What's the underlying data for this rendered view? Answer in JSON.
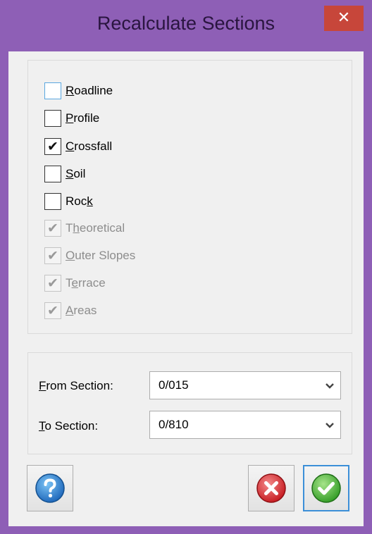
{
  "window": {
    "title": "Recalculate Sections",
    "close_glyph": "✕"
  },
  "checkboxes": [
    {
      "pre": "",
      "ak": "R",
      "post": "oadline",
      "checked": false,
      "enabled": true
    },
    {
      "pre": "",
      "ak": "P",
      "post": "rofile",
      "checked": false,
      "enabled": true
    },
    {
      "pre": "",
      "ak": "C",
      "post": "rossfall",
      "checked": true,
      "enabled": true
    },
    {
      "pre": "",
      "ak": "S",
      "post": "oil",
      "checked": false,
      "enabled": true
    },
    {
      "pre": "Roc",
      "ak": "k",
      "post": "",
      "checked": false,
      "enabled": true
    },
    {
      "pre": "T",
      "ak": "h",
      "post": "eoretical",
      "checked": true,
      "enabled": false
    },
    {
      "pre": "",
      "ak": "O",
      "post": "uter Slopes",
      "checked": true,
      "enabled": false
    },
    {
      "pre": "T",
      "ak": "e",
      "post": "rrace",
      "checked": true,
      "enabled": false
    },
    {
      "pre": "",
      "ak": "A",
      "post": "reas",
      "checked": true,
      "enabled": false
    }
  ],
  "from_section": {
    "ak": "F",
    "rest": "rom Section:",
    "value": "0/015"
  },
  "to_section": {
    "ak": "T",
    "rest": "o Section:",
    "value": "0/810"
  },
  "buttons": {
    "help_icon": "help-icon",
    "cancel_icon": "cancel-icon",
    "ok_icon": "ok-check-icon"
  },
  "colors": {
    "titlebar": "#8e5fb6",
    "close": "#c7463a",
    "dialog_bg": "#f0f0f0"
  }
}
